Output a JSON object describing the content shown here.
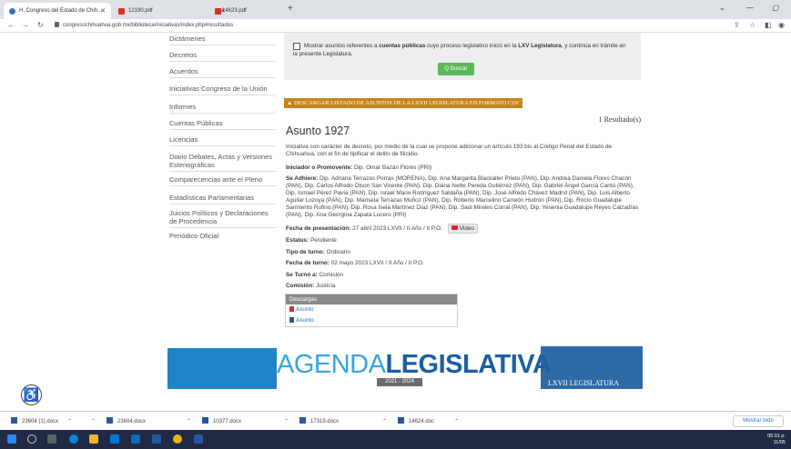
{
  "browser": {
    "tabs": [
      {
        "label": "H. Congreso del Estado de Chih...",
        "active": true,
        "color": "#3b73b9"
      },
      {
        "label": "12190.pdf",
        "active": false,
        "color": "#d93025"
      },
      {
        "label": "14623.pdf",
        "active": false,
        "color": "#d93025"
      }
    ],
    "new_tab": "+",
    "url": "congresochihuahua.gob.mx/biblioteca/iniciativas/index.php#resultados"
  },
  "sidebar": {
    "items": [
      {
        "label": "Dictámenes"
      },
      {
        "label": "Decretos"
      },
      {
        "label": "Acuerdos"
      },
      {
        "label": "Iniciativas Congreso de la Unión"
      },
      {
        "label": "Informes"
      },
      {
        "label": "Cuentas Públicas"
      },
      {
        "label": "Licencias"
      },
      {
        "label": "Diario Debates, Actas y Versiones Estenográficas"
      },
      {
        "label": "Comparecencias ante el Pleno"
      },
      {
        "label": "Estadísticas Parlamentarias"
      },
      {
        "label": "Juicios Políticos y Declaraciones de Procedencia"
      },
      {
        "label": "Periódico Oficial"
      }
    ]
  },
  "filter": {
    "text_a": "Mostrar asuntos referentes a ",
    "text_bold1": "cuentas públicas",
    "text_b": " cuyo proceso legislativo inició en la ",
    "text_bold2": "LXV Legislatura",
    "text_c": ", y continúa en trámite en la presente Legislatura.",
    "search_button": "Q Buscar"
  },
  "csv_button": "DESCARGAR LISTADO DE ASUNTOS DE LA LXVII LEGISLATURA EN FORMATO CSV",
  "results_count": "1 Resultado(s)",
  "asunto": {
    "title": "Asunto 1927",
    "description": "Iniciativa con carácter de decreto, por medio de la cual se propone adicionar un artículo 193 bis al Código Penal del Estado de Chihuahua, con el fin de tipificar el delito de filicidio.",
    "promovente_label": "Iniciador o Promovente:",
    "promovente": "Dip. Omar Bazán Flores (PRI)",
    "adhiere_label": "Se Adhiere:",
    "adhiere": "Dip. Adriana Terrazas Porras (MORENA), Dip. Ana Margarita Blackaller Prieto (PAN), Dip. Andrea Daniela Flores Chacón (PAN), Dip. Carlos Alfredo Olson San Vicente (PAN), Dip. Diana Ivette Pereda Gutiérrez (PAN), Dip. Gabriel Ángel García Cantú (PAN), Dip. Ismael Pérez Pavía (PAN), Dip. Israel Mario Rodríguez Saldaña (PAN), Dip. José Alfredo Chávez Madrid (PAN), Dip. Luis Alberto Aguilar Lozoya (PAN), Dip. Marisela Terrazas Muñoz (PAN), Dip. Roberto Marcelino Carreón Huitrón (PAN), Dip. Rocío Guadalupe Sarmiento Rufino (PAN), Dip. Rosa Isela Martínez Díaz (PAN), Dip. Saúl Mireles Corral (PAN), Dip. Yesenia Guadalupe Reyes Calzadías (PAN), Dip. Ana Georgina Zapata Lucero (PRI)",
    "fecha_presentacion_label": "Fecha de presentación:",
    "fecha_presentacion": "27 abril 2023   LXVII / II Año / II P.O.",
    "video_label": "Video",
    "estatus_label": "Estatus:",
    "estatus": "Pendiente",
    "tipo_turno_label": "Tipo de turno:",
    "tipo_turno": "Ordinario",
    "fecha_turno_label": "Fecha de turno:",
    "fecha_turno": "02 mayo 2023   LXVII / II Año / II P.O.",
    "se_turno_label": "Se Turnó a:",
    "se_turno": "Comisión",
    "comision_label": "Comisión:",
    "comision": "Justicia"
  },
  "downloads_box": {
    "header": "Descargas",
    "items": [
      {
        "label": "Asunto",
        "icon": "pdf-icon",
        "color": "#d93025"
      },
      {
        "label": "Asunto",
        "icon": "word-icon",
        "color": "#2b579a"
      }
    ]
  },
  "banner": {
    "word1": "AGENDA",
    "word2": "LEGISLATIVA",
    "years": "2021 - 2024",
    "legislatura": "LXVII LEGISLATURA"
  },
  "download_bar": {
    "items": [
      {
        "label": "23604 (1).docx"
      },
      {
        "label": "23604.docx"
      },
      {
        "label": "10377.docx"
      },
      {
        "label": "17319.docx"
      },
      {
        "label": "14624.doc"
      }
    ],
    "show_all": "Mostrar todo"
  },
  "clock": {
    "time": "05:01 p.",
    "date": "11/05"
  }
}
